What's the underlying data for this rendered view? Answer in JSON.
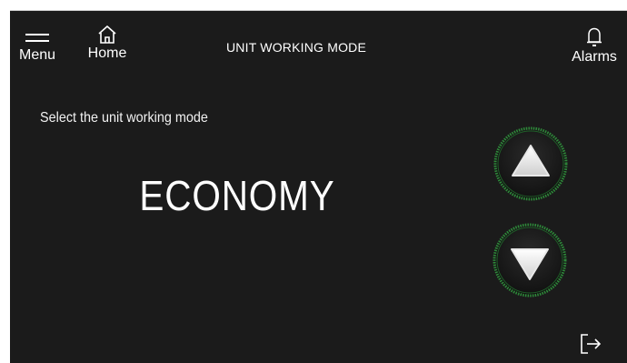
{
  "header": {
    "title": "UNIT WORKING MODE",
    "menu_label": "Menu",
    "home_label": "Home",
    "alarms_label": "Alarms"
  },
  "main": {
    "prompt": "Select the unit working mode",
    "selected_mode": "ECONOMY"
  },
  "icons": {
    "menu": "hamburger-icon",
    "home": "home-icon",
    "alarms": "bell-icon",
    "up": "triangle-up-icon",
    "down": "triangle-down-icon",
    "exit": "exit-icon"
  },
  "colors": {
    "background": "#1b1b1b",
    "text": "#ffffff",
    "button_ring": "#2e8b3a"
  }
}
